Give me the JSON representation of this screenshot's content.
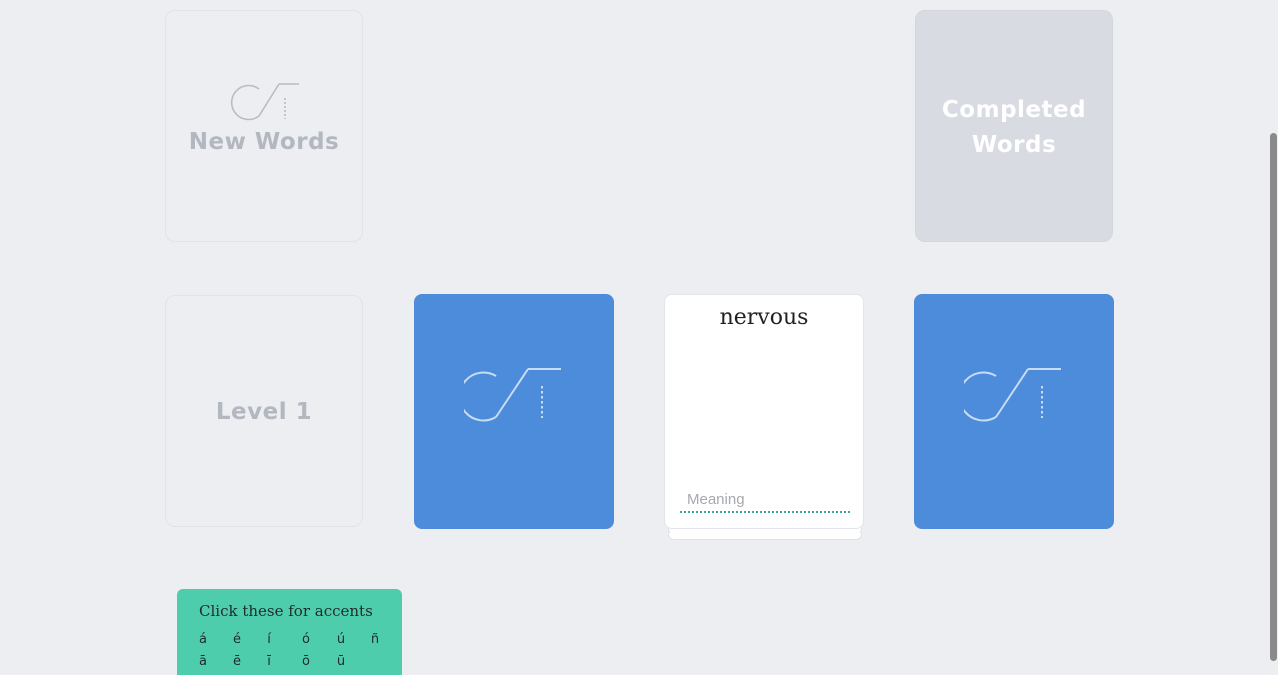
{
  "slots": {
    "new_words": "New Words",
    "completed_words_line1": "Completed",
    "completed_words_line2": "Words",
    "level": "Level 1"
  },
  "active_card": {
    "word": "nervous",
    "meaning_value": "",
    "meaning_placeholder": "Meaning"
  },
  "accents": {
    "title": "Click these for accents",
    "row1": [
      "á",
      "é",
      "í",
      "ó",
      "ú",
      "ñ"
    ],
    "row2": [
      "ā",
      "ē",
      "ī",
      "ō",
      "ū"
    ]
  },
  "icons": {
    "logo": "ct-logo-icon"
  },
  "colors": {
    "card_blue": "#4d8cdb",
    "accent_panel": "#4ecdac",
    "background": "#eceef1"
  }
}
